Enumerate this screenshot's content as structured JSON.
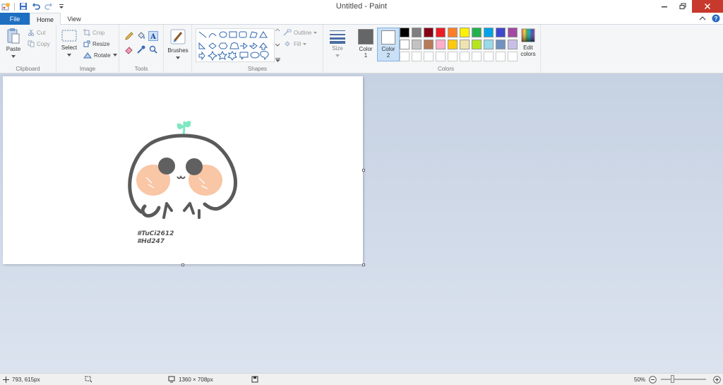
{
  "window": {
    "title": "Untitled - Paint"
  },
  "tabs": {
    "file": "File",
    "home": "Home",
    "view": "View"
  },
  "clipboard": {
    "group": "Clipboard",
    "paste": "Paste",
    "cut": "Cut",
    "copy": "Copy"
  },
  "image": {
    "group": "Image",
    "select": "Select",
    "crop": "Crop",
    "resize": "Resize",
    "rotate": "Rotate"
  },
  "tools": {
    "group": "Tools"
  },
  "brushes": {
    "label": "Brushes"
  },
  "shapes": {
    "group": "Shapes",
    "outline": "Outline",
    "fill": "Fill"
  },
  "size": {
    "label": "Size"
  },
  "colors": {
    "group": "Colors",
    "color1_label": "Color",
    "color1_num": "1",
    "color2_label": "Color",
    "color2_num": "2",
    "edit_label": "Edit",
    "edit_label2": "colors",
    "color1": "#666666",
    "color2": "#ffffff",
    "row1": [
      "#000000",
      "#7f7f7f",
      "#880015",
      "#ed1c24",
      "#ff7f27",
      "#fff200",
      "#22b14c",
      "#00a2e8",
      "#3f48cc",
      "#a349a4"
    ],
    "row2": [
      "#ffffff",
      "#c3c3c3",
      "#b97a57",
      "#ffaec9",
      "#ffc90e",
      "#efe4b0",
      "#b5e61d",
      "#99d9ea",
      "#7092be",
      "#c8bfe7"
    ]
  },
  "canvas": {
    "tag1": "#TuCi2612",
    "tag2": "#Hd247"
  },
  "statusbar": {
    "cursor_pos": "793, 615px",
    "image_size": "1360 × 708px",
    "zoom": "50%"
  }
}
